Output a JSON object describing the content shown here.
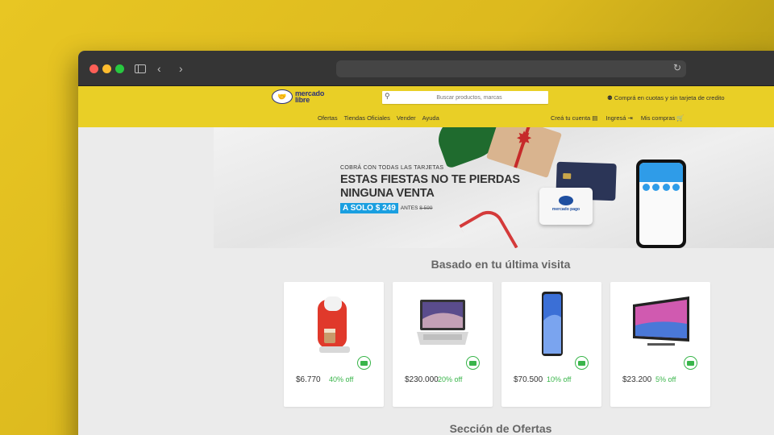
{
  "browser": {
    "back_icon": "chevron-left-icon",
    "forward_icon": "chevron-right-icon"
  },
  "header": {
    "logo_line1": "mercado",
    "logo_line2": "libre",
    "search_placeholder": "Buscar productos, marcas",
    "promo": "Comprá en cuotas y sin tarjeta de credito",
    "nav": [
      "Ofertas",
      "Tiendas Oficiales",
      "Vender",
      "Ayuda"
    ],
    "account": "Creá tu cuenta",
    "login": "Ingresá",
    "purchases": "Mis compras"
  },
  "banner": {
    "subtitle": "COBRÁ CON TODAS LAS TARJETAS",
    "title": "ESTAS FIESTAS NO TE PIERDAS NINGUNA VENTA",
    "price": "A SOLO $ 249",
    "before_label": "ANTES",
    "before_price": "$ 599",
    "card_text": "mercado pago"
  },
  "sections": {
    "recent": "Basado en tu última visita",
    "offers": "Sección de Ofertas"
  },
  "products": [
    {
      "price": "$6.770",
      "discount": "40% off"
    },
    {
      "price": "$230.000",
      "discount": "20% off"
    },
    {
      "price": "$70.500",
      "discount": "10% off"
    },
    {
      "price": "$23.200",
      "discount": "5% off"
    }
  ],
  "colors": {
    "header_yellow": "#e9cf26",
    "accent_green": "#39b54a",
    "price_tag_blue": "#1a9fe0"
  }
}
